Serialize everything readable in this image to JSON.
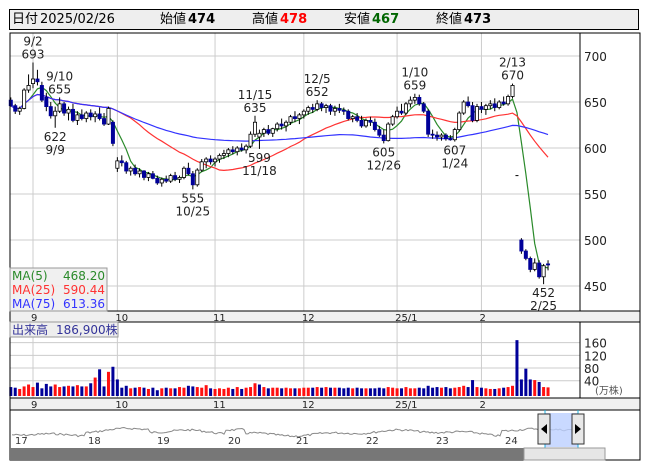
{
  "header": {
    "date_label": "日付",
    "date": "2025/02/26",
    "open_label": "始値",
    "open": "474",
    "high_label": "高値",
    "high": "478",
    "low_label": "安値",
    "low": "467",
    "close_label": "終値",
    "close": "473"
  },
  "colors": {
    "up_volume": "#ff1111",
    "down_volume": "#000099",
    "flat_volume": "#888888",
    "down_candle": "#000099",
    "ma5": "#2a8a2a",
    "ma25": "#ff3333",
    "ma75": "#3333ff",
    "high_value": "#ff0000",
    "low_value": "#006600"
  },
  "legend": {
    "ma5_label": "MA(5)",
    "ma5_value": "468.20",
    "ma25_label": "MA(25)",
    "ma25_value": "590.44",
    "ma75_label": "MA(75)",
    "ma75_value": "613.36"
  },
  "volume_legend": {
    "label": "出来高",
    "value": "186,900株"
  },
  "chart_data": {
    "type": "candlestick",
    "price_axis": {
      "ticks": [
        "700",
        "650",
        "600",
        "550",
        "500",
        "450"
      ],
      "range": [
        435,
        720
      ]
    },
    "volume_axis": {
      "ticks": [
        "160",
        "120",
        "80",
        "40"
      ],
      "unit": "(万株)",
      "range": [
        0,
        170
      ]
    },
    "month_ticks": [
      {
        "date": "9/2",
        "label": "9"
      },
      {
        "date": "10/1",
        "label": "10"
      },
      {
        "date": "11/1",
        "label": "11"
      },
      {
        "date": "12/2",
        "label": "12"
      },
      {
        "date": "1/6",
        "label": "25/1"
      },
      {
        "date": "2/3",
        "label": "2"
      }
    ],
    "annotations": [
      {
        "date": "9/2",
        "type": "high",
        "date_text": "9/2",
        "price_text": "693"
      },
      {
        "date": "9/10",
        "type": "high",
        "date_text": "9/10",
        "price_text": "655"
      },
      {
        "date": "9/9",
        "type": "low",
        "date_text": "9/9",
        "price_text": "622"
      },
      {
        "date": "10/25",
        "type": "low",
        "date_text": "10/25",
        "price_text": "555"
      },
      {
        "date": "11/15",
        "type": "high",
        "date_text": "11/15",
        "price_text": "635"
      },
      {
        "date": "11/18",
        "type": "low",
        "date_text": "11/18",
        "price_text": "599"
      },
      {
        "date": "12/5",
        "type": "high",
        "date_text": "12/5",
        "price_text": "652"
      },
      {
        "date": "12/26",
        "type": "low",
        "date_text": "12/26",
        "price_text": "605"
      },
      {
        "date": "1/10",
        "type": "high",
        "date_text": "1/10",
        "price_text": "659"
      },
      {
        "date": "1/24",
        "type": "low",
        "date_text": "1/24",
        "price_text": "607"
      },
      {
        "date": "2/13",
        "type": "high",
        "date_text": "2/13",
        "price_text": "670"
      },
      {
        "date": "2/25",
        "type": "low",
        "date_text": "2/25",
        "price_text": "452"
      }
    ],
    "candles_columns": [
      "date",
      "open",
      "high",
      "low",
      "close",
      "volume_10k"
    ],
    "candles": [
      [
        "8/26",
        652,
        655,
        645,
        646,
        20
      ],
      [
        "8/27",
        646,
        648,
        637,
        640,
        18
      ],
      [
        "8/28",
        640,
        645,
        636,
        643,
        14
      ],
      [
        "8/29",
        643,
        665,
        642,
        663,
        22
      ],
      [
        "8/30",
        663,
        680,
        660,
        668,
        28
      ],
      [
        "9/2",
        670,
        693,
        665,
        675,
        20
      ],
      [
        "9/3",
        675,
        685,
        668,
        672,
        34
      ],
      [
        "9/4",
        668,
        672,
        650,
        652,
        16
      ],
      [
        "9/5",
        655,
        660,
        640,
        645,
        30
      ],
      [
        "9/6",
        645,
        650,
        632,
        635,
        22
      ],
      [
        "9/9",
        635,
        645,
        622,
        640,
        28
      ],
      [
        "9/10",
        640,
        655,
        638,
        648,
        20
      ],
      [
        "9/11",
        648,
        650,
        635,
        638,
        22
      ],
      [
        "9/12",
        638,
        645,
        630,
        642,
        24
      ],
      [
        "9/13",
        642,
        648,
        628,
        630,
        22
      ],
      [
        "9/17",
        630,
        640,
        625,
        636,
        26
      ],
      [
        "9/18",
        636,
        642,
        630,
        632,
        22
      ],
      [
        "9/19",
        632,
        640,
        628,
        638,
        22
      ],
      [
        "9/20",
        638,
        642,
        630,
        634,
        32
      ],
      [
        "9/24",
        634,
        640,
        628,
        637,
        50
      ],
      [
        "9/25",
        637,
        644,
        630,
        632,
        76
      ],
      [
        "9/26",
        632,
        638,
        624,
        626,
        22
      ],
      [
        "9/27",
        626,
        645,
        625,
        643,
        68
      ],
      [
        "9/30",
        628,
        630,
        602,
        605,
        84
      ],
      [
        "10/1",
        578,
        590,
        574,
        586,
        44
      ],
      [
        "10/2",
        586,
        592,
        580,
        584,
        18
      ],
      [
        "10/3",
        584,
        586,
        572,
        575,
        24
      ],
      [
        "10/4",
        575,
        580,
        570,
        578,
        16
      ],
      [
        "10/7",
        578,
        582,
        570,
        572,
        18
      ],
      [
        "10/8",
        572,
        578,
        568,
        575,
        20
      ],
      [
        "10/9",
        575,
        576,
        565,
        568,
        18
      ],
      [
        "10/10",
        568,
        574,
        564,
        572,
        14
      ],
      [
        "10/11",
        572,
        575,
        566,
        567,
        18
      ],
      [
        "10/15",
        567,
        570,
        560,
        562,
        10
      ],
      [
        "10/16",
        562,
        568,
        558,
        566,
        16
      ],
      [
        "10/17",
        566,
        570,
        562,
        564,
        18
      ],
      [
        "10/18",
        564,
        572,
        562,
        570,
        16
      ],
      [
        "10/21",
        570,
        574,
        564,
        566,
        16
      ],
      [
        "10/22",
        566,
        570,
        562,
        568,
        20
      ],
      [
        "10/23",
        568,
        580,
        566,
        578,
        18
      ],
      [
        "10/24",
        578,
        584,
        570,
        572,
        24
      ],
      [
        "10/25",
        572,
        575,
        555,
        560,
        22
      ],
      [
        "10/28",
        560,
        578,
        558,
        576,
        20
      ],
      [
        "10/29",
        576,
        588,
        574,
        585,
        18
      ],
      [
        "10/30",
        585,
        590,
        578,
        588,
        26
      ],
      [
        "10/31",
        588,
        592,
        582,
        585,
        16
      ],
      [
        "11/1",
        585,
        590,
        580,
        588,
        14
      ],
      [
        "11/5",
        588,
        594,
        584,
        592,
        16
      ],
      [
        "11/6",
        592,
        598,
        588,
        594,
        14
      ],
      [
        "11/7",
        594,
        600,
        590,
        598,
        18
      ],
      [
        "11/8",
        598,
        602,
        593,
        596,
        14
      ],
      [
        "11/11",
        596,
        602,
        592,
        600,
        20
      ],
      [
        "11/12",
        600,
        605,
        596,
        598,
        14
      ],
      [
        "11/13",
        598,
        604,
        594,
        602,
        18
      ],
      [
        "11/14",
        602,
        618,
        600,
        615,
        20
      ],
      [
        "11/15",
        615,
        635,
        612,
        628,
        32
      ],
      [
        "11/18",
        612,
        620,
        599,
        616,
        28
      ],
      [
        "11/19",
        616,
        622,
        612,
        620,
        20
      ],
      [
        "11/20",
        620,
        625,
        614,
        616,
        16
      ],
      [
        "11/21",
        616,
        622,
        612,
        621,
        18
      ],
      [
        "11/22",
        621,
        628,
        618,
        626,
        18
      ],
      [
        "11/25",
        626,
        632,
        620,
        624,
        16
      ],
      [
        "11/26",
        624,
        630,
        618,
        628,
        18
      ],
      [
        "11/27",
        628,
        636,
        625,
        634,
        16
      ],
      [
        "11/28",
        634,
        640,
        628,
        632,
        16
      ],
      [
        "11/29",
        632,
        638,
        626,
        636,
        16
      ],
      [
        "12/2",
        636,
        642,
        632,
        640,
        18
      ],
      [
        "12/3",
        640,
        646,
        636,
        644,
        18
      ],
      [
        "12/4",
        644,
        648,
        638,
        642,
        18
      ],
      [
        "12/5",
        642,
        652,
        640,
        648,
        20
      ],
      [
        "12/6",
        648,
        650,
        640,
        644,
        18
      ],
      [
        "12/9",
        644,
        648,
        638,
        646,
        20
      ],
      [
        "12/10",
        646,
        648,
        636,
        640,
        18
      ],
      [
        "12/11",
        640,
        646,
        635,
        643,
        18
      ],
      [
        "12/12",
        643,
        648,
        638,
        641,
        18
      ],
      [
        "12/13",
        641,
        644,
        636,
        640,
        16
      ],
      [
        "12/16",
        640,
        642,
        630,
        632,
        18
      ],
      [
        "12/17",
        632,
        636,
        628,
        634,
        16
      ],
      [
        "12/18",
        634,
        638,
        628,
        630,
        18
      ],
      [
        "12/19",
        630,
        635,
        622,
        624,
        16
      ],
      [
        "12/20",
        624,
        632,
        622,
        630,
        16
      ],
      [
        "12/23",
        630,
        634,
        624,
        628,
        16
      ],
      [
        "12/24",
        628,
        632,
        618,
        620,
        16
      ],
      [
        "12/25",
        620,
        624,
        612,
        614,
        18
      ],
      [
        "12/26",
        614,
        620,
        605,
        608,
        16
      ],
      [
        "12/27",
        608,
        628,
        607,
        626,
        20
      ],
      [
        "12/30",
        626,
        636,
        624,
        634,
        18
      ],
      [
        "1/6",
        634,
        645,
        632,
        640,
        16
      ],
      [
        "1/7",
        640,
        648,
        636,
        638,
        16
      ],
      [
        "1/8",
        638,
        650,
        636,
        648,
        20
      ],
      [
        "1/9",
        648,
        656,
        644,
        652,
        16
      ],
      [
        "1/10",
        652,
        659,
        648,
        655,
        16
      ],
      [
        "1/14",
        655,
        658,
        646,
        648,
        18
      ],
      [
        "1/15",
        648,
        650,
        638,
        640,
        16
      ],
      [
        "1/16",
        640,
        642,
        612,
        615,
        24
      ],
      [
        "1/17",
        615,
        620,
        610,
        614,
        18
      ],
      [
        "1/20",
        614,
        618,
        608,
        612,
        20
      ],
      [
        "1/21",
        612,
        616,
        608,
        614,
        18
      ],
      [
        "1/22",
        614,
        616,
        608,
        610,
        20
      ],
      [
        "1/23",
        610,
        614,
        608,
        609,
        16
      ],
      [
        "1/24",
        609,
        622,
        607,
        620,
        18
      ],
      [
        "1/27",
        620,
        640,
        618,
        638,
        20
      ],
      [
        "1/28",
        638,
        652,
        636,
        650,
        24
      ],
      [
        "1/29",
        650,
        656,
        644,
        646,
        20
      ],
      [
        "1/30",
        646,
        650,
        628,
        630,
        42
      ],
      [
        "1/31",
        630,
        648,
        628,
        645,
        20
      ],
      [
        "2/3",
        645,
        650,
        638,
        642,
        18
      ],
      [
        "2/4",
        642,
        648,
        636,
        646,
        16
      ],
      [
        "2/5",
        646,
        652,
        642,
        648,
        14
      ],
      [
        "2/6",
        648,
        654,
        640,
        644,
        14
      ],
      [
        "2/7",
        644,
        652,
        642,
        650,
        16
      ],
      [
        "2/10",
        650,
        656,
        646,
        648,
        18
      ],
      [
        "2/12",
        648,
        658,
        646,
        656,
        20
      ],
      [
        "2/13",
        656,
        670,
        654,
        668,
        24
      ],
      [
        "2/14",
        570,
        570,
        570,
        570,
        168
      ],
      [
        "2/17",
        500,
        502,
        485,
        488,
        44
      ],
      [
        "2/18",
        488,
        490,
        478,
        480,
        78
      ],
      [
        "2/19",
        480,
        482,
        465,
        468,
        44
      ],
      [
        "2/20",
        468,
        480,
        466,
        475,
        42
      ],
      [
        "2/21",
        475,
        478,
        458,
        460,
        36
      ],
      [
        "2/25",
        460,
        474,
        452,
        472,
        20
      ],
      [
        "2/26",
        474,
        478,
        467,
        473,
        19
      ]
    ],
    "navigator": {
      "year_labels": [
        "17",
        "18",
        "19",
        "20",
        "21",
        "22",
        "23",
        "24",
        "2"
      ]
    }
  }
}
